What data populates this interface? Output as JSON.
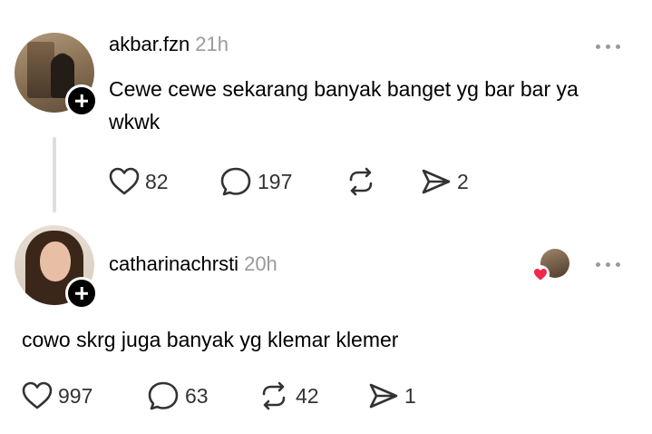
{
  "posts": [
    {
      "username": "akbar.fzn",
      "time": "21h",
      "text_line1": "Cewe cewe sekarang banyak banget yg bar bar ya",
      "text_line2": "wkwk",
      "likes": "82",
      "replies": "197",
      "reposts": "",
      "shares": "2"
    },
    {
      "username": "catharinachrsti",
      "time": "20h",
      "text_line1": "cowo skrg juga banyak yg klemar klemer",
      "likes": "997",
      "replies": "63",
      "reposts": "42",
      "shares": "1"
    }
  ],
  "icons": {
    "like": "heart-outline-icon",
    "reply": "speech-bubble-icon",
    "repost": "repost-arrows-icon",
    "share": "send-icon",
    "more": "more-dots-icon",
    "follow": "plus-icon"
  },
  "colors": {
    "text": "#000000",
    "muted": "#9a9a9a",
    "icon": "#333333",
    "thread_line": "#dedede",
    "heart": "#f02849"
  }
}
